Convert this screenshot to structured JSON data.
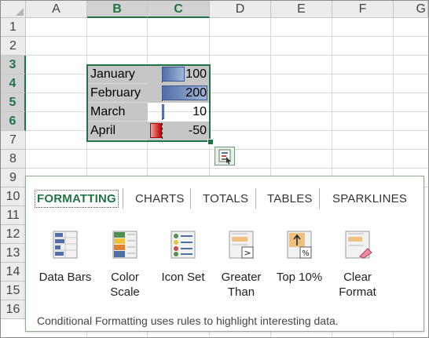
{
  "columns": [
    "A",
    "B",
    "C",
    "D",
    "E",
    "F",
    "G"
  ],
  "rows": [
    "1",
    "2",
    "3",
    "4",
    "5",
    "6",
    "7",
    "8",
    "9",
    "10",
    "11",
    "12",
    "13",
    "14",
    "15",
    "16"
  ],
  "data_rows": [
    {
      "month": "January",
      "value": "100",
      "amount": 100
    },
    {
      "month": "February",
      "value": "200",
      "amount": 200
    },
    {
      "month": "March",
      "value": "10",
      "amount": 10
    },
    {
      "month": "April",
      "value": "-50",
      "amount": -50
    }
  ],
  "quick_analysis": {
    "tabs": [
      "FORMATTING",
      "CHARTS",
      "TOTALS",
      "TABLES",
      "SPARKLINES"
    ],
    "options": [
      {
        "line1": "Data Bars",
        "line2": "",
        "icon": "data-bars-icon"
      },
      {
        "line1": "Color",
        "line2": "Scale",
        "icon": "color-scale-icon"
      },
      {
        "line1": "Icon Set",
        "line2": "",
        "icon": "icon-set-icon"
      },
      {
        "line1": "Greater",
        "line2": "Than",
        "icon": "greater-than-icon"
      },
      {
        "line1": "Top 10%",
        "line2": "",
        "icon": "top-10-percent-icon"
      },
      {
        "line1": "Clear",
        "line2": "Format",
        "icon": "clear-format-icon"
      }
    ],
    "description": "Conditional Formatting uses rules to highlight interesting data."
  },
  "colors": {
    "accent": "#217346",
    "bar_positive": "#4f6fa8",
    "bar_negative": "#c00000"
  }
}
